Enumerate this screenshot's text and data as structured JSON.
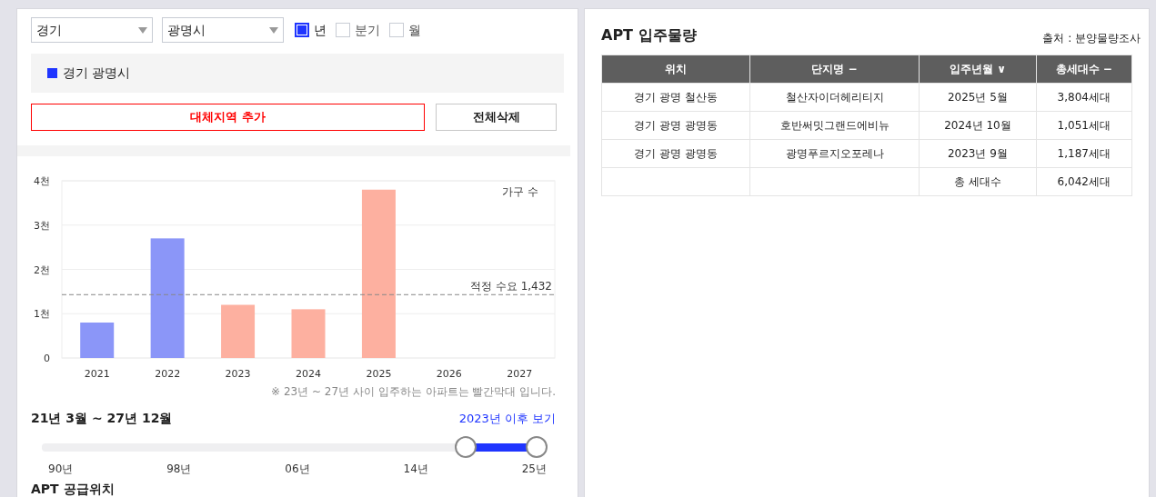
{
  "filters": {
    "province": "경기",
    "city": "광명시",
    "periods": [
      {
        "label": "년",
        "selected": true
      },
      {
        "label": "분기",
        "selected": false
      },
      {
        "label": "월",
        "selected": false
      }
    ]
  },
  "region_list": [
    {
      "label": "경기 광명시",
      "color": "#1f35ff"
    }
  ],
  "buttons": {
    "add_region": "대체지역 추가",
    "clear_all": "전체삭제"
  },
  "chart": {
    "legend": "가구 수",
    "chart_data": {
      "type": "bar",
      "categories": [
        "2021",
        "2022",
        "2023",
        "2024",
        "2025",
        "2026",
        "2027"
      ],
      "series": [
        {
          "color": "#8b96f8",
          "values": [
            0.8,
            2.7,
            null,
            null,
            null,
            null,
            null
          ]
        },
        {
          "color": "#fdb0a0",
          "values": [
            null,
            null,
            1.2,
            1.1,
            3.8,
            null,
            null
          ]
        }
      ],
      "ylim": [
        0,
        4
      ],
      "yticks": [
        {
          "value": 0,
          "label": "0"
        },
        {
          "value": 1,
          "label": "1천"
        },
        {
          "value": 2,
          "label": "2천"
        },
        {
          "value": 3,
          "label": "3천"
        },
        {
          "value": 4,
          "label": "4천"
        }
      ],
      "stacked": true,
      "grid": true,
      "ref_lines": [
        {
          "axis": "y",
          "value": 1.43,
          "label": "적정 수요 1,432"
        }
      ]
    }
  },
  "note": "※ 23년 ~ 27년 사이 입주하는 아파트는 빨간막대 입니다.",
  "range": {
    "label": "21년 3월 ~ 27년 12월",
    "link": "2023년 이후 보기",
    "thumbs": [
      {
        "level": 0.84
      },
      {
        "level": 0.98
      }
    ],
    "ticks": [
      "90년",
      "98년",
      "06년",
      "14년",
      "25년"
    ]
  },
  "next_section_title": "APT 공급위치",
  "table": {
    "title": "APT 입주물량",
    "source": "출처 : 분양물량조사",
    "columns": [
      "위치",
      "단지명 −",
      "입주년월 ∨",
      "총세대수 −"
    ],
    "rows": [
      [
        "경기 광명 철산동",
        "철산자이더헤리티지",
        "2025년 5월",
        "3,804세대"
      ],
      [
        "경기 광명 광명동",
        "호반써밋그랜드에비뉴",
        "2024년 10월",
        "1,051세대"
      ],
      [
        "경기 광명 광명동",
        "광명푸르지오포레나",
        "2023년 9월",
        "1,187세대"
      ],
      [
        "",
        "",
        "총 세대수",
        "6,042세대"
      ]
    ]
  }
}
